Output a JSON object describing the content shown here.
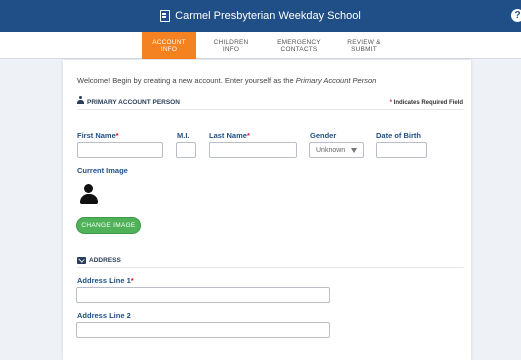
{
  "header": {
    "title": "Carmel Presbyterian Weekday School",
    "help_label": "?"
  },
  "steps": [
    {
      "label": "ACCOUNT\nINFO",
      "active": true
    },
    {
      "label": "CHILDREN\nINFO",
      "active": false
    },
    {
      "label": "EMERGENCY\nCONTACTS",
      "active": false
    },
    {
      "label": "REVIEW &\nSUBMIT",
      "active": false
    }
  ],
  "intro": {
    "text_before": "Welcome! Begin by creating a new account. Enter yourself as the ",
    "text_emphasis": "Primary Account Person"
  },
  "primary_section": {
    "title": "PRIMARY ACCOUNT PERSON",
    "required_note_star": "*",
    "required_note_text": " Indicates Required Field"
  },
  "fields": {
    "first_name": {
      "label": "First Name",
      "required": "*",
      "value": ""
    },
    "middle_initial": {
      "label": "M.I.",
      "value": ""
    },
    "last_name": {
      "label": "Last Name",
      "required": "*",
      "value": ""
    },
    "gender": {
      "label": "Gender",
      "value": "Unknown"
    },
    "dob": {
      "label": "Date of Birth",
      "value": ""
    }
  },
  "image": {
    "label": "Current Image",
    "button": "CHANGE IMAGE"
  },
  "address_section": {
    "title": "ADDRESS"
  },
  "address": {
    "line1": {
      "label": "Address Line 1",
      "required": "*",
      "value": ""
    },
    "line2": {
      "label": "Address Line 2",
      "value": ""
    }
  }
}
